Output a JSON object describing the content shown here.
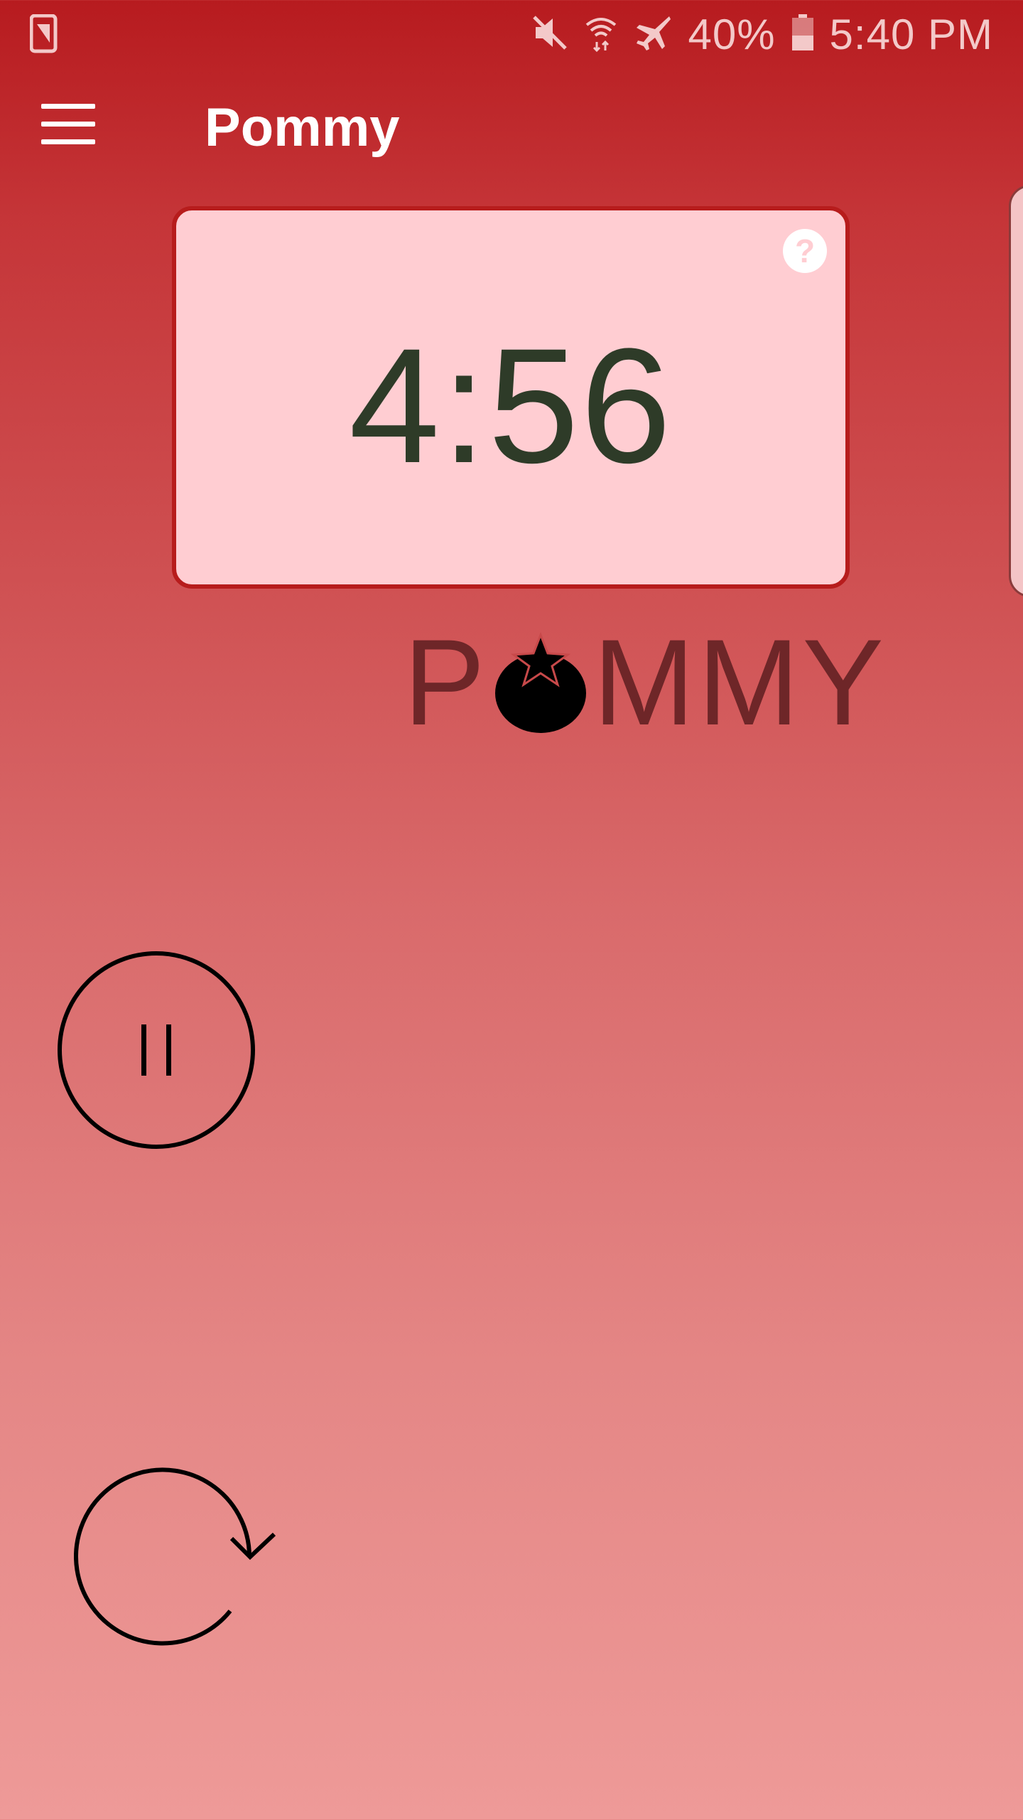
{
  "status_bar": {
    "battery": "40%",
    "time": "5:40 PM",
    "icons": [
      "sim-card-icon",
      "mute-icon",
      "wifi-icon",
      "airplane-mode-icon",
      "battery-icon"
    ]
  },
  "app_bar": {
    "title": "Pommy",
    "menu_icon": "hamburger-menu-icon"
  },
  "timer": {
    "display": "4:56",
    "help_icon": "?"
  },
  "logo": {
    "prefix": "P",
    "suffix": "MMY",
    "icon": "tomato-icon"
  },
  "controls": {
    "pause_icon": "pause-icon",
    "reset_icon": "reset-icon"
  },
  "colors": {
    "header": "#b71b1f",
    "card_bg": "#ffcdd2",
    "card_border": "#b71c1c",
    "timer_text": "#2e3b28",
    "logo_text": "#6e2628"
  }
}
